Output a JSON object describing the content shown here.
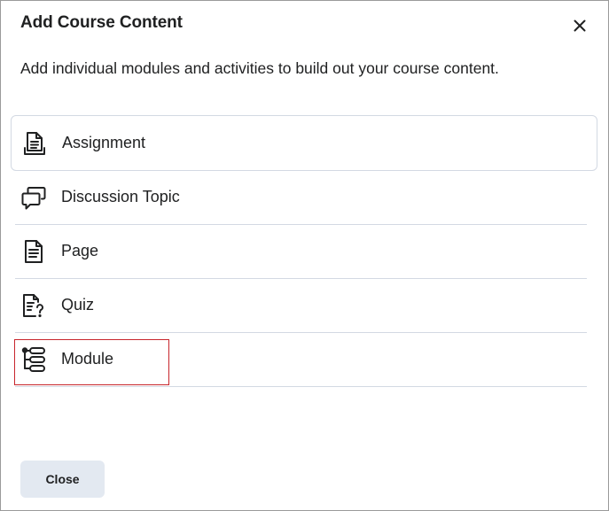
{
  "dialog": {
    "title": "Add Course Content",
    "close_icon": "close-icon",
    "description": "Add individual modules and activities to build out your course content."
  },
  "items": [
    {
      "label": "Assignment",
      "icon": "assignment-icon"
    },
    {
      "label": "Discussion Topic",
      "icon": "discussion-icon"
    },
    {
      "label": "Page",
      "icon": "page-icon"
    },
    {
      "label": "Quiz",
      "icon": "quiz-icon"
    },
    {
      "label": "Module",
      "icon": "module-icon"
    }
  ],
  "highlight": {
    "target": "Module",
    "color": "#c8262c"
  },
  "footer": {
    "close_label": "Close"
  },
  "colors": {
    "text": "#202122",
    "divider": "#d3d9e3",
    "button_bg": "#e3e9f1"
  }
}
